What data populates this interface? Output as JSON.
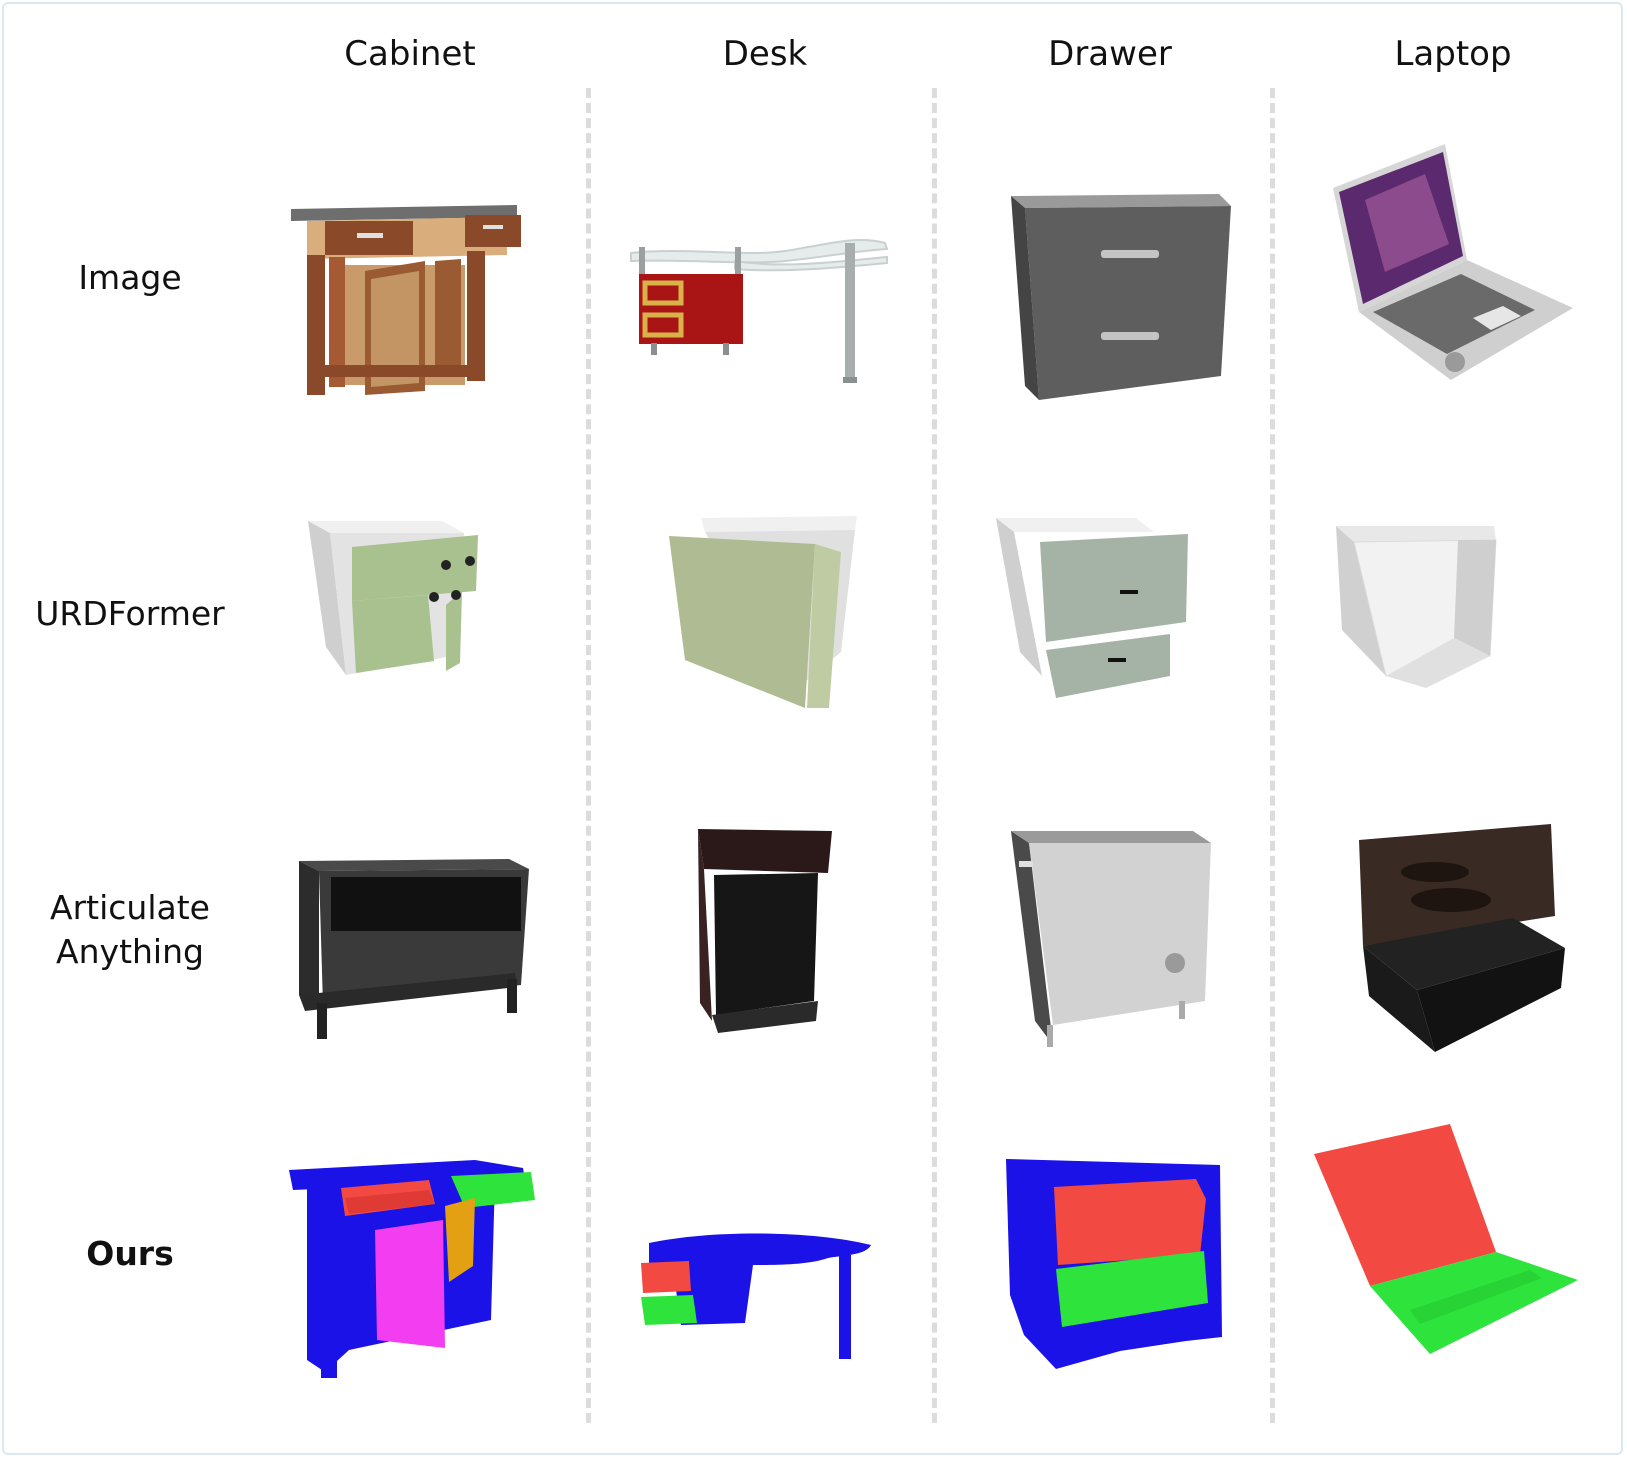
{
  "columns": [
    "Cabinet",
    "Desk",
    "Drawer",
    "Laptop"
  ],
  "rows": [
    "Image",
    "URDFormer",
    "Articulate Anything",
    "Ours"
  ],
  "rows_multiline": {
    "articulate": [
      "Articulate",
      "Anything"
    ]
  },
  "colors": {
    "ours_base": "#1a12e6",
    "ours_part_red": "#f24a42",
    "ours_part_green": "#2ee43c",
    "ours_part_magenta": "#f23ef0",
    "ours_part_orange": "#e2a012",
    "urdformer_body": "#dcdcdc",
    "urdformer_door": "#a9c08f",
    "articulate_dark": "#222222",
    "divider": "#dcdcdc",
    "border": "#dbe8f2"
  }
}
